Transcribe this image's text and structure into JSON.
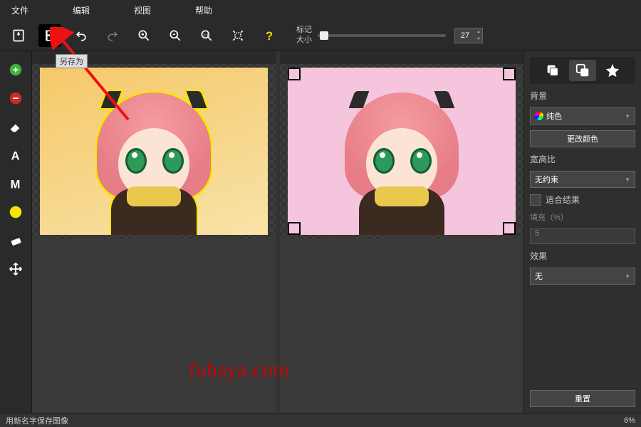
{
  "menu": {
    "file": "文件",
    "edit": "编辑",
    "view": "视图",
    "help": "帮助"
  },
  "toolbar": {
    "slider_label": "标记\n大小",
    "spinner_value": "27"
  },
  "tooltip": {
    "save_as": "另存为"
  },
  "right": {
    "section_bg": "背景",
    "select_solid": "纯色",
    "btn_change_color": "更改颜色",
    "section_ratio": "宽高比",
    "select_unconstrained": "无约束",
    "checkbox_fit": "适合结果",
    "fill_label": "填充（%）",
    "fill_value": "5",
    "section_effect": "效果",
    "select_none": "无",
    "btn_reset": "重置"
  },
  "status": {
    "left": "用新名字保存图像",
    "right": "6%"
  },
  "watermark": "fubaya.com"
}
